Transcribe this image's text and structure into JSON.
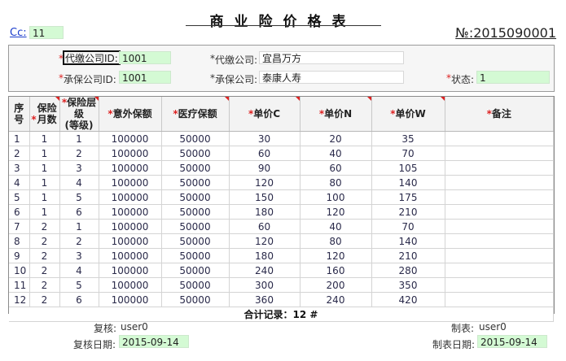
{
  "header": {
    "title": "商业险价格表",
    "cc_label": "Cc:",
    "cc_value": "11",
    "doc_no": "№:2015090001"
  },
  "form": {
    "payer_id_label": "代缴公司ID:",
    "payer_id_value": "1001",
    "payer_name_label": "代缴公司:",
    "payer_name_value": "宜昌万方",
    "insurer_id_label": "承保公司ID:",
    "insurer_id_value": "1001",
    "insurer_name_label": "承保公司:",
    "insurer_name_value": "泰康人寿",
    "status_label": "状态:",
    "status_value": "1",
    "star": "*"
  },
  "table": {
    "headers": {
      "seq": "序号",
      "months": "保险月数",
      "level": "保险层级",
      "level_sub": "(等级)",
      "accident": "意外保额",
      "medical": "医疗保额",
      "price_c": "单价C",
      "price_n": "单价N",
      "price_w": "单价W",
      "remark": "备注"
    },
    "rows": [
      {
        "seq": "1",
        "months": "1",
        "level": "1",
        "accident": "100000",
        "medical": "50000",
        "c": "30",
        "n": "20",
        "w": "35",
        "remark": ""
      },
      {
        "seq": "2",
        "months": "1",
        "level": "2",
        "accident": "100000",
        "medical": "50000",
        "c": "60",
        "n": "40",
        "w": "70",
        "remark": ""
      },
      {
        "seq": "3",
        "months": "1",
        "level": "3",
        "accident": "100000",
        "medical": "50000",
        "c": "90",
        "n": "60",
        "w": "105",
        "remark": ""
      },
      {
        "seq": "4",
        "months": "1",
        "level": "4",
        "accident": "100000",
        "medical": "50000",
        "c": "120",
        "n": "80",
        "w": "140",
        "remark": ""
      },
      {
        "seq": "5",
        "months": "1",
        "level": "5",
        "accident": "100000",
        "medical": "50000",
        "c": "150",
        "n": "100",
        "w": "175",
        "remark": ""
      },
      {
        "seq": "6",
        "months": "1",
        "level": "6",
        "accident": "100000",
        "medical": "50000",
        "c": "180",
        "n": "120",
        "w": "210",
        "remark": ""
      },
      {
        "seq": "7",
        "months": "2",
        "level": "1",
        "accident": "100000",
        "medical": "50000",
        "c": "60",
        "n": "40",
        "w": "70",
        "remark": ""
      },
      {
        "seq": "8",
        "months": "2",
        "level": "2",
        "accident": "100000",
        "medical": "50000",
        "c": "120",
        "n": "80",
        "w": "140",
        "remark": ""
      },
      {
        "seq": "9",
        "months": "2",
        "level": "3",
        "accident": "100000",
        "medical": "50000",
        "c": "180",
        "n": "120",
        "w": "210",
        "remark": ""
      },
      {
        "seq": "10",
        "months": "2",
        "level": "4",
        "accident": "100000",
        "medical": "50000",
        "c": "240",
        "n": "160",
        "w": "280",
        "remark": ""
      },
      {
        "seq": "11",
        "months": "2",
        "level": "5",
        "accident": "100000",
        "medical": "50000",
        "c": "300",
        "n": "200",
        "w": "350",
        "remark": ""
      },
      {
        "seq": "12",
        "months": "2",
        "level": "6",
        "accident": "100000",
        "medical": "50000",
        "c": "360",
        "n": "240",
        "w": "420",
        "remark": ""
      }
    ],
    "summary": "合计记录：12 #"
  },
  "footer": {
    "reviewer_label": "复核:",
    "reviewer_value": "user0",
    "review_date_label": "复核日期:",
    "review_date_value": "2015-09-14",
    "maker_label": "制表:",
    "maker_value": "user0",
    "make_date_label": "制表日期:",
    "make_date_value": "2015-09-14"
  },
  "colors": {
    "field_green": "#d4fad4",
    "required_star": "#dd2222",
    "link_blue": "#1a3ccc"
  }
}
